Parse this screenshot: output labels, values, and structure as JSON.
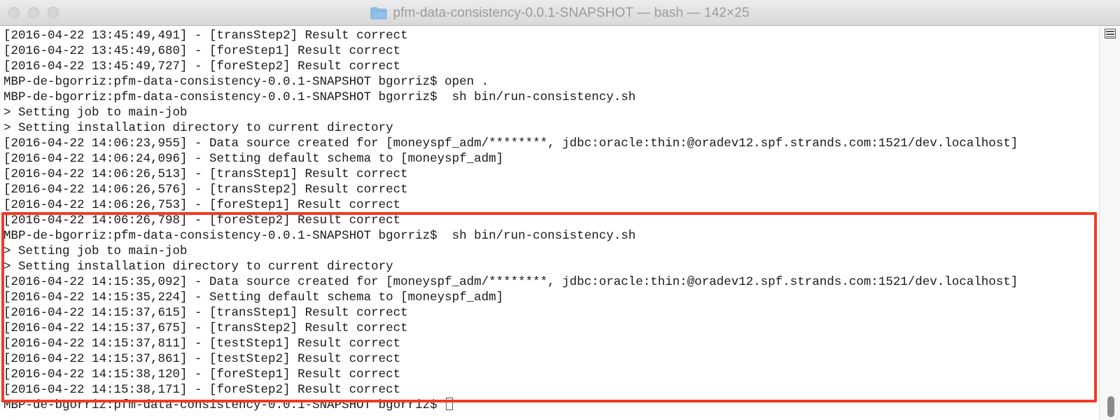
{
  "window": {
    "title": "pfm-data-consistency-0.0.1-SNAPSHOT — bash — 142×25",
    "icon": "folder-icon"
  },
  "colors": {
    "highlight": "#f13a25",
    "text": "#1a1a1a",
    "title": "#9b9b9b"
  },
  "terminal": {
    "lines": [
      "[2016-04-22 13:45:49,491] - [transStep2] Result correct",
      "[2016-04-22 13:45:49,680] - [foreStep1] Result correct",
      "[2016-04-22 13:45:49,727] - [foreStep2] Result correct",
      "MBP-de-bgorriz:pfm-data-consistency-0.0.1-SNAPSHOT bgorriz$ open .",
      "MBP-de-bgorriz:pfm-data-consistency-0.0.1-SNAPSHOT bgorriz$  sh bin/run-consistency.sh",
      "> Setting job to main-job",
      "> Setting installation directory to current directory",
      "[2016-04-22 14:06:23,955] - Data source created for [moneyspf_adm/********, jdbc:oracle:thin:@oradev12.spf.strands.com:1521/dev.localhost]",
      "[2016-04-22 14:06:24,096] - Setting default schema to [moneyspf_adm]",
      "[2016-04-22 14:06:26,513] - [transStep1] Result correct",
      "[2016-04-22 14:06:26,576] - [transStep2] Result correct",
      "[2016-04-22 14:06:26,753] - [foreStep1] Result correct",
      "[2016-04-22 14:06:26,798] - [foreStep2] Result correct",
      "MBP-de-bgorriz:pfm-data-consistency-0.0.1-SNAPSHOT bgorriz$  sh bin/run-consistency.sh",
      "> Setting job to main-job",
      "> Setting installation directory to current directory",
      "[2016-04-22 14:15:35,092] - Data source created for [moneyspf_adm/********, jdbc:oracle:thin:@oradev12.spf.strands.com:1521/dev.localhost]",
      "[2016-04-22 14:15:35,224] - Setting default schema to [moneyspf_adm]",
      "[2016-04-22 14:15:37,615] - [transStep1] Result correct",
      "[2016-04-22 14:15:37,675] - [transStep2] Result correct",
      "[2016-04-22 14:15:37,811] - [testStep1] Result correct",
      "[2016-04-22 14:15:37,861] - [testStep2] Result correct",
      "[2016-04-22 14:15:38,120] - [foreStep1] Result correct",
      "[2016-04-22 14:15:38,171] - [foreStep2] Result correct"
    ],
    "prompt": "MBP-de-bgorriz:pfm-data-consistency-0.0.1-SNAPSHOT bgorriz$ "
  }
}
